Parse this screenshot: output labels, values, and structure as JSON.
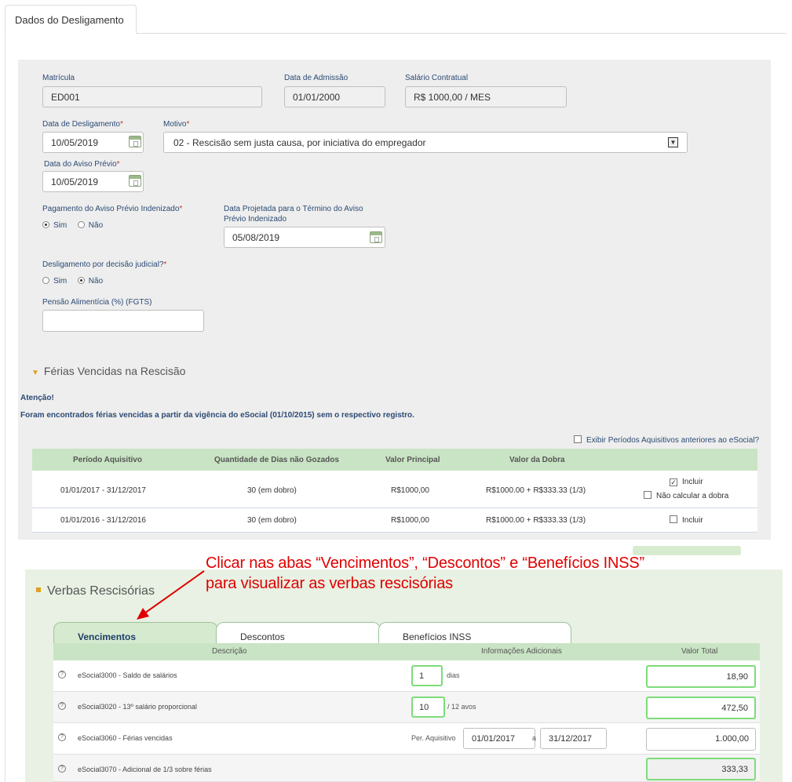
{
  "top_tab": "Dados do Desligamento",
  "matricula": {
    "label": "Matrícula",
    "value": "ED001"
  },
  "admissao": {
    "label": "Data de Admissão",
    "value": "01/01/2000"
  },
  "salario": {
    "label": "Salário Contratual",
    "value": "R$ 1000,00 / MES"
  },
  "desligamento": {
    "label": "Data de Desligamento",
    "value": "10/05/2019"
  },
  "motivo": {
    "label": "Motivo",
    "value": "02 - Rescisão sem justa causa, por iniciativa do empregador"
  },
  "aviso": {
    "label": "Data do Aviso Prévio",
    "value": "10/05/2019"
  },
  "pagamento_aviso": {
    "label": "Pagamento do Aviso Prévio Indenizado",
    "sim": "Sim",
    "nao": "Não"
  },
  "data_projetada": {
    "label_line1": "Data Projetada para o Término do Aviso",
    "label_line2": "Prévio Indenizado",
    "value": "05/08/2019"
  },
  "judicial": {
    "label": "Desligamento por decisão judicial?",
    "sim": "Sim",
    "nao": "Não"
  },
  "pensao": {
    "label": "Pensão Alimentícia (%) (FGTS)",
    "value": ""
  },
  "ferias": {
    "title": "Férias Vencidas na Rescisão",
    "atencao": "Atenção!",
    "message": "Foram encontrados férias vencidas a partir da vigência do eSocial (01/10/2015) sem o respectivo registro.",
    "exibir": "Exibir Períodos Aquisitivos anteriores ao eSocial?",
    "headers": [
      "Período Aquisitivo",
      "Quantidade de Dias não Gozados",
      "Valor Principal",
      "Valor da Dobra"
    ],
    "rows": [
      {
        "periodo": "01/01/2017 - 31/12/2017",
        "dias": "30 (em dobro)",
        "principal": "R$1000,00",
        "dobra": "R$1000.00 + R$333.33 (1/3)",
        "incluir": "Incluir",
        "nao_calcular": "Não calcular a dobra"
      },
      {
        "periodo": "01/01/2016 - 31/12/2016",
        "dias": "30 (em dobro)",
        "principal": "R$1000,00",
        "dobra": "R$1000.00 + R$333.33 (1/3)",
        "incluir": "Incluir"
      }
    ]
  },
  "annotation": {
    "line1": "Clicar nas abas “Vencimentos”, “Descontos” e “Benefícios INSS”",
    "line2": "para visualizar as verbas rescisórias"
  },
  "verbas": {
    "title": "Verbas Rescisórias",
    "tabs": [
      "Vencimentos",
      "Descontos",
      "Benefícios INSS"
    ],
    "headers": [
      "Descrição",
      "Informações Adicionais",
      "Valor Total"
    ],
    "rows": [
      {
        "desc": "eSocial3000 - Saldo de salários",
        "qty": "1",
        "unit": "dias",
        "total": "18,90"
      },
      {
        "desc": "eSocial3020 - 13º salário proporcional",
        "qty": "10",
        "unit": "/ 12 avos",
        "total": "472,50"
      },
      {
        "desc": "eSocial3060 - Férias vencidas",
        "per_label": "Per. Aquisitivo",
        "from": "01/01/2017",
        "sep": "a",
        "to": "31/12/2017",
        "total": "1.000,00"
      },
      {
        "desc": "eSocial3070 - Adicional de 1/3 sobre férias",
        "total": "333,33"
      }
    ]
  },
  "colors": {
    "panel": "#eeeeee",
    "table_header": "#c9e4c4",
    "accent": "#e0a020",
    "annotation": "#e00000",
    "highlight_border": "#7ddc7a"
  }
}
